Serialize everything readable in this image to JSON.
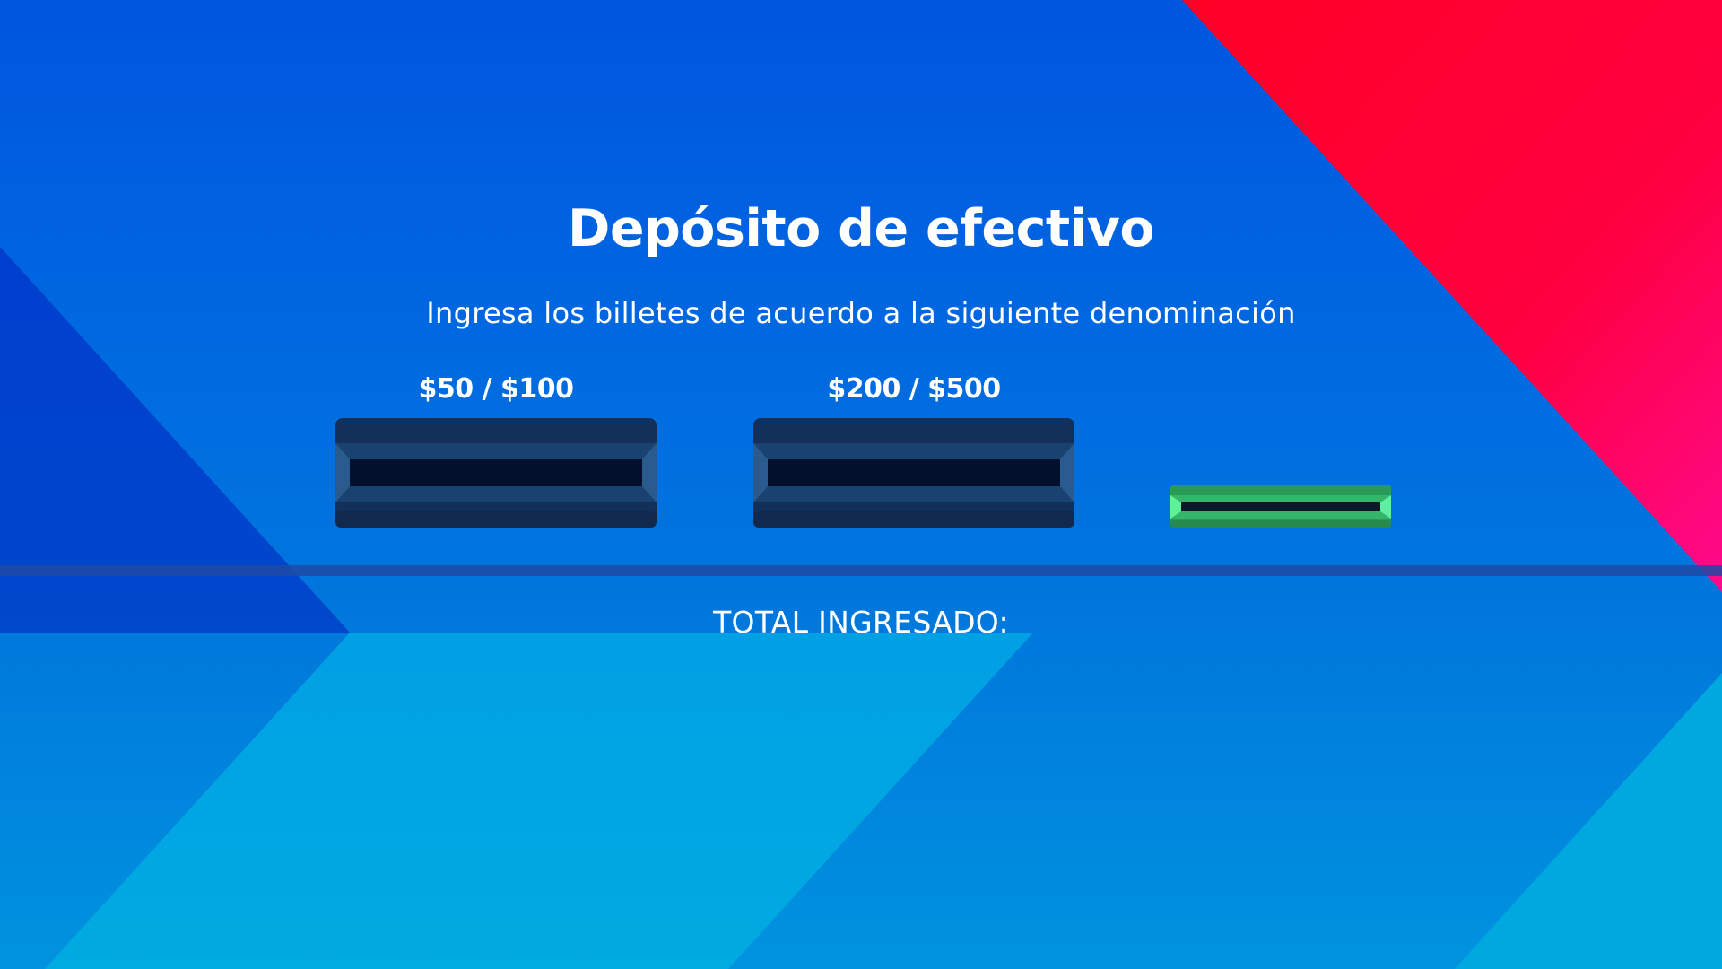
{
  "screen": {
    "title": "Depósito de efectivo",
    "subtitle": "Ingresa los billetes de acuerdo a la siguiente denominación"
  },
  "slots": [
    {
      "label": "$50 / $100",
      "icon": "bill-slot-icon",
      "color": "#163a66"
    },
    {
      "label": "$200 / $500",
      "icon": "bill-slot-icon",
      "color": "#163a66"
    },
    {
      "label": "",
      "icon": "coin-slot-icon",
      "color": "#2e9a5a"
    }
  ],
  "total": {
    "label": "TOTAL INGRESADO:"
  },
  "colors": {
    "background_blue": "#0055df",
    "accent_red": "#ff0030",
    "accent_pink": "#ff0080",
    "slot_dark": "#0a1430",
    "slot_green": "#3ed77d"
  }
}
